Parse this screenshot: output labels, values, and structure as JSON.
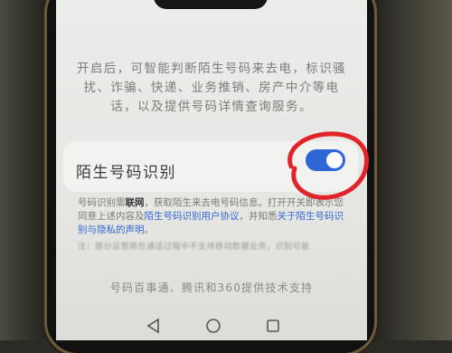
{
  "description": "开启后，可智能判断陌生号码来去电，标识骚扰、诈骗、快递、业务推销、房产中介等电话，以及提供号码详情查询服务。",
  "setting": {
    "label": "陌生号码识别",
    "toggle_on": true
  },
  "note": {
    "part1": "号码识别需",
    "bold": "联网",
    "part2": "，获取陌生来去电号码信息。打开开关即表示您同意上述内容及",
    "link1": "陌生号码识别用户协议",
    "part3": "，并知悉",
    "link2": "关于陌生号码识别与隐私的声明",
    "part4": "。"
  },
  "footnote": "注：部分运营商在通话过程中不支持移动数据业务，识别可能",
  "credits": "号码百事通、腾讯和360提供技术支持",
  "colors": {
    "toggle_on": "#2f66d6",
    "link": "#3469d4",
    "annotation_circle": "#e0242a"
  },
  "icons": {
    "back": "triangle-left-icon",
    "home": "circle-icon",
    "recents": "square-icon"
  }
}
